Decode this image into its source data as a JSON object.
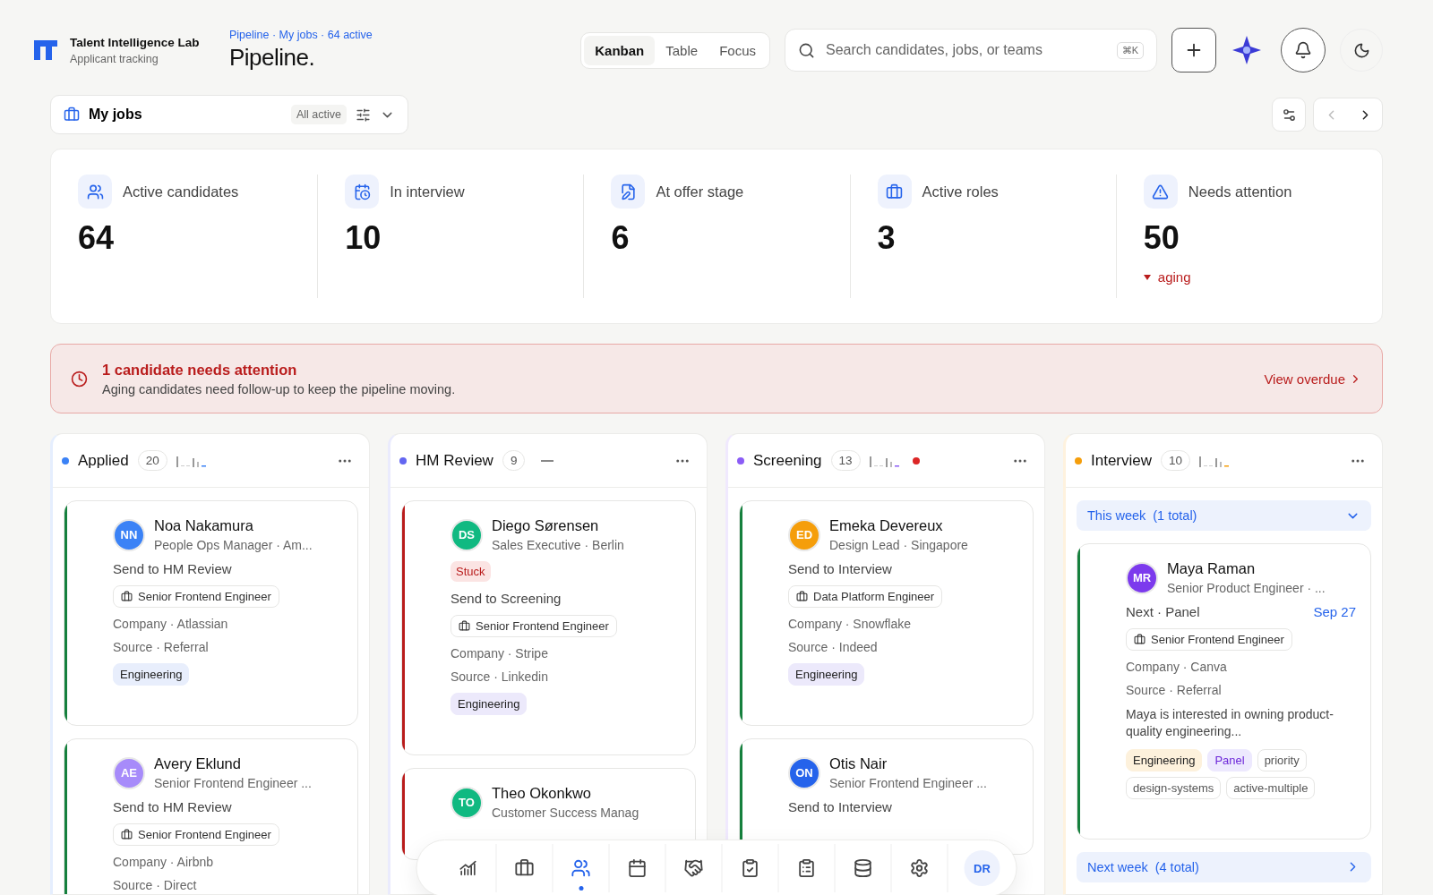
{
  "brand": {
    "name": "Talent Intelligence Lab",
    "subtitle": "Applicant tracking"
  },
  "breadcrumb": "Pipeline · My jobs · 64 active",
  "page_title": "Pipeline.",
  "view_tabs": [
    {
      "label": "Kanban",
      "selected": true
    },
    {
      "label": "Table",
      "selected": false
    },
    {
      "label": "Focus",
      "selected": false
    }
  ],
  "search": {
    "placeholder": "Search candidates, jobs, or teams",
    "shortcut": "⌘K"
  },
  "job_filter": {
    "label": "My jobs",
    "scope": "All active"
  },
  "pager": {
    "prev_disabled": true,
    "next_disabled": false
  },
  "stats": [
    {
      "label": "Active candidates",
      "value": "64"
    },
    {
      "label": "In interview",
      "value": "10"
    },
    {
      "label": "At offer stage",
      "value": "6"
    },
    {
      "label": "Active roles",
      "value": "3"
    },
    {
      "label": "Needs attention",
      "value": "50",
      "delta": "aging"
    }
  ],
  "alert": {
    "title": "1 candidate needs attention",
    "message": "Aging candidates need follow-up to keep the pipeline moving.",
    "link": "View overdue"
  },
  "columns": [
    {
      "name": "Applied",
      "count": "20",
      "color": "#3b82f6",
      "has_trend": true,
      "alert": false,
      "items": [
        {
          "kind": "card",
          "avatar": {
            "initials": "NN",
            "color": "#3b82f6"
          },
          "color": "#15803d",
          "name": "Noa Nakamura",
          "subtitle": "People Ops Manager · Am...",
          "action": "Send to HM Review",
          "job": "Senior Frontend Engineer",
          "company": "Company · Atlassian",
          "source": "Source · Referral",
          "tags": [
            {
              "label": "Engineering",
              "kind": "chip",
              "color": "#e8eefc"
            }
          ]
        },
        {
          "kind": "card",
          "avatar": {
            "initials": "AE",
            "color": "#a78bfa"
          },
          "color": "#15803d",
          "name": "Avery Eklund",
          "subtitle": "Senior Frontend Engineer ...",
          "action": "Send to HM Review",
          "job": "Senior Frontend Engineer",
          "company": "Company · Airbnb",
          "source": "Source · Direct"
        }
      ]
    },
    {
      "name": "HM Review",
      "count": "9",
      "color": "#6366f1",
      "has_trend": false,
      "alert": false,
      "items": [
        {
          "kind": "card",
          "avatar": {
            "initials": "DS",
            "color": "#10b981"
          },
          "color": "#b91c1c",
          "name": "Diego Sørensen",
          "subtitle": "Sales Executive · Berlin",
          "badge": "Stuck",
          "action": "Send to Screening",
          "job": "Senior Frontend Engineer",
          "company": "Company · Stripe",
          "source": "Source · Linkedin",
          "tags": [
            {
              "label": "Engineering",
              "kind": "chip",
              "color": "#ece9fb"
            }
          ]
        },
        {
          "kind": "card",
          "avatar": {
            "initials": "TO",
            "color": "#10b981"
          },
          "color": "#b91c1c",
          "name": "Theo Okonkwo",
          "subtitle": "Customer Success Manag"
        }
      ]
    },
    {
      "name": "Screening",
      "count": "13",
      "color": "#8b5cf6",
      "has_trend": true,
      "alert": true,
      "items": [
        {
          "kind": "card",
          "avatar": {
            "initials": "ED",
            "color": "#f59e0b"
          },
          "color": "#15803d",
          "name": "Emeka Devereux",
          "subtitle": "Design Lead · Singapore",
          "action": "Send to Interview",
          "job": "Data Platform Engineer",
          "company": "Company · Snowflake",
          "source": "Source · Indeed",
          "tags": [
            {
              "label": "Engineering",
              "kind": "chip",
              "color": "#ece9fb"
            }
          ]
        },
        {
          "kind": "card",
          "avatar": {
            "initials": "ON",
            "color": "#2563eb"
          },
          "color": "#15803d",
          "name": "Otis Nair",
          "subtitle": "Senior Frontend Engineer ...",
          "action": "Send to Interview"
        }
      ]
    },
    {
      "name": "Interview",
      "count": "10",
      "color": "#f59e0b",
      "has_trend": true,
      "alert": false,
      "items": [
        {
          "kind": "group",
          "label": "This week",
          "total": "(1 total)",
          "expanded": true
        },
        {
          "kind": "card",
          "avatar": {
            "initials": "MR",
            "color": "#7c3aed"
          },
          "color": "#15803d",
          "name": "Maya Raman",
          "subtitle": "Senior Product Engineer · ...",
          "next": "Next · Panel",
          "date": "Sep 27",
          "job": "Senior Frontend Engineer",
          "company": "Company · Canva",
          "source": "Source · Referral",
          "note": "Maya is interested in owning product-quality engineering...",
          "tags": [
            {
              "label": "Engineering",
              "kind": "chip",
              "color": "#fdf1dc"
            },
            {
              "label": "Panel",
              "kind": "stage",
              "color": "#ede9fe"
            },
            {
              "label": "priority",
              "kind": "outline",
              "color": "#ffffff"
            },
            {
              "label": "design-systems",
              "kind": "outline",
              "color": "#ffffff"
            },
            {
              "label": "active-multiple",
              "kind": "outline",
              "color": "#ffffff"
            }
          ]
        },
        {
          "kind": "group",
          "label": "Next week",
          "total": "(4 total)",
          "expanded": false
        }
      ]
    }
  ],
  "dock": {
    "items": [
      {
        "selected": false
      },
      {
        "selected": false
      },
      {
        "selected": true
      },
      {
        "selected": false
      },
      {
        "selected": false
      },
      {
        "selected": false
      },
      {
        "selected": false
      },
      {
        "selected": false
      },
      {
        "selected": false
      }
    ],
    "user": "DR"
  }
}
